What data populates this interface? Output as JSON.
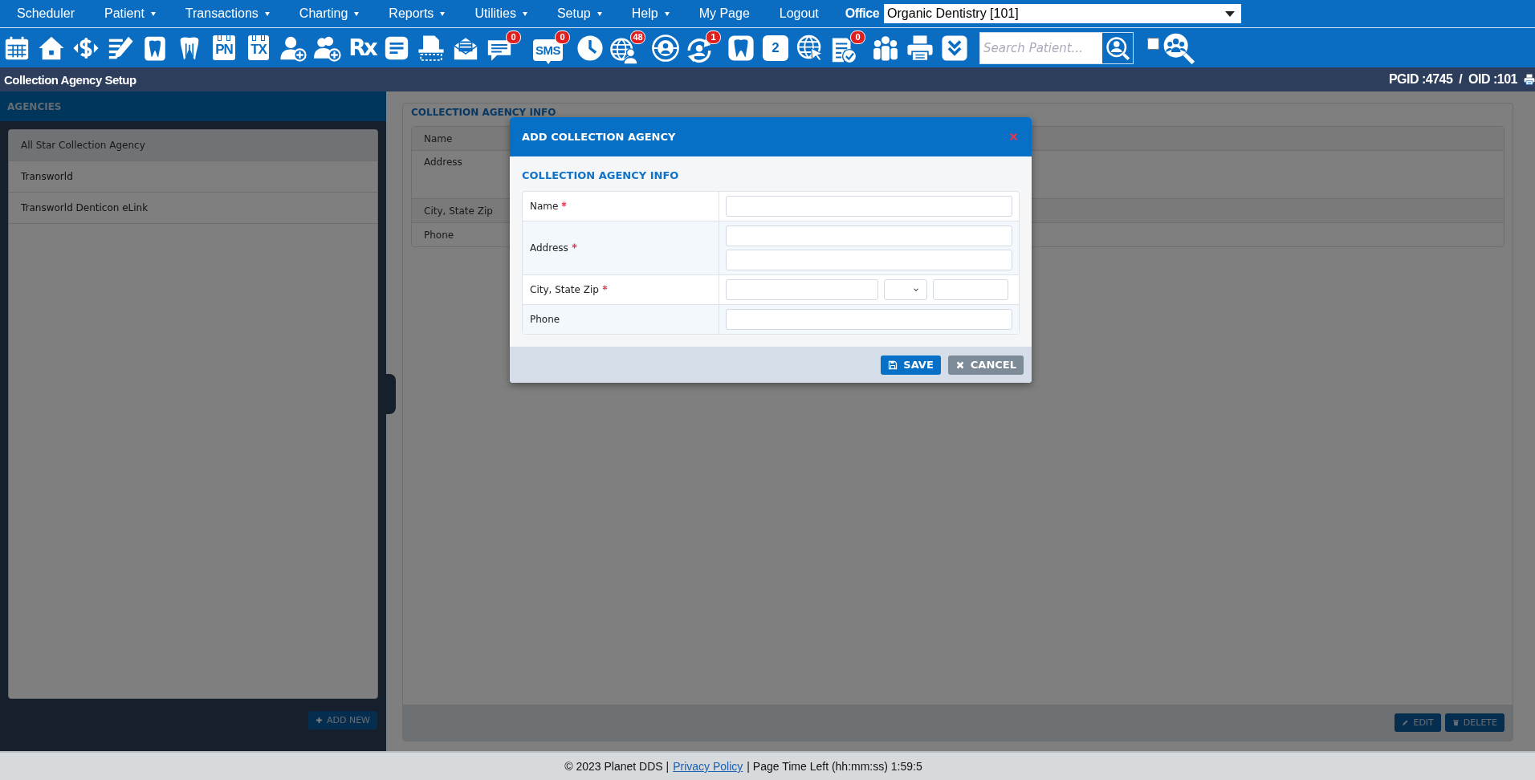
{
  "menu": {
    "items": [
      {
        "label": "Scheduler",
        "dropdown": false
      },
      {
        "label": "Patient",
        "dropdown": true
      },
      {
        "label": "Transactions",
        "dropdown": true
      },
      {
        "label": "Charting",
        "dropdown": true
      },
      {
        "label": "Reports",
        "dropdown": true
      },
      {
        "label": "Utilities",
        "dropdown": true
      },
      {
        "label": "Setup",
        "dropdown": true
      },
      {
        "label": "Help",
        "dropdown": true
      },
      {
        "label": "My Page",
        "dropdown": false
      },
      {
        "label": "Logout",
        "dropdown": false
      }
    ],
    "office_label": "Office",
    "office_select": {
      "value": "Organic Dentistry [101]"
    }
  },
  "toolbar": {
    "buttons": [
      {
        "kind": "calendar"
      },
      {
        "kind": "home"
      },
      {
        "kind": "dollar"
      },
      {
        "kind": "edit_list"
      },
      {
        "kind": "tooth_box"
      },
      {
        "kind": "tooth_roots"
      },
      {
        "kind": "labeled_calendar",
        "label": "PN"
      },
      {
        "kind": "labeled_calendar",
        "label": "TX"
      },
      {
        "kind": "person_add"
      },
      {
        "kind": "people_add"
      },
      {
        "kind": "rx",
        "label": "Rx"
      },
      {
        "kind": "note"
      },
      {
        "kind": "scanner"
      },
      {
        "kind": "mail"
      },
      {
        "kind": "chat",
        "badge": "0"
      },
      {
        "kind": "sms",
        "label": "SMS",
        "badge": "0"
      },
      {
        "kind": "clock"
      },
      {
        "kind": "globe_person",
        "badge": "48"
      },
      {
        "kind": "globe_circle"
      },
      {
        "kind": "refresh_person",
        "badge": "1"
      },
      {
        "kind": "tooth"
      },
      {
        "kind": "tooth_label",
        "label": "2"
      },
      {
        "kind": "globe_cursor"
      },
      {
        "kind": "doc_check",
        "badge": "0"
      },
      {
        "kind": "group"
      },
      {
        "kind": "printer"
      },
      {
        "kind": "chevrons"
      }
    ],
    "search": {
      "placeholder": "Search Patient..."
    },
    "checkbox": {
      "checked": false
    }
  },
  "title_bar": {
    "title": "Collection Agency Setup",
    "ids": "PGID :4745  /  OID :101"
  },
  "agencies": {
    "title": "AGENCIES",
    "items": [
      {
        "label": "All Star Collection Agency",
        "selected": true
      },
      {
        "label": "Transworld",
        "selected": false
      },
      {
        "label": "Transworld Denticon eLink",
        "selected": false
      }
    ],
    "add_button": "ADD NEW"
  },
  "info": {
    "title": "COLLECTION AGENCY INFO",
    "rows": [
      {
        "label": "Name",
        "kind": "single"
      },
      {
        "label": "Address",
        "kind": "double"
      },
      {
        "label": "City, State Zip",
        "kind": "single"
      },
      {
        "label": "Phone",
        "kind": "single"
      }
    ],
    "buttons": [
      {
        "kind": "edit",
        "label": "EDIT"
      },
      {
        "kind": "delete",
        "label": "DELETE"
      }
    ]
  },
  "dialog": {
    "title": "ADD COLLECTION AGENCY",
    "section": "COLLECTION AGENCY INFO",
    "fields": [
      {
        "kind": "text",
        "label": "Name",
        "required": true
      },
      {
        "kind": "address",
        "label": "Address",
        "required": true
      },
      {
        "kind": "city_state_zip",
        "label": "City, State Zip",
        "required": true
      },
      {
        "kind": "text",
        "label": "Phone",
        "required": false
      }
    ],
    "buttons": [
      {
        "kind": "save",
        "label": "SAVE"
      },
      {
        "kind": "cancel",
        "label": "CANCEL"
      }
    ]
  },
  "footer": {
    "copyright": "© 2023 Planet DDS |",
    "link": "Privacy Policy",
    "time_left": "|  Page Time Left (hh:mm:ss) 1:59:5"
  }
}
